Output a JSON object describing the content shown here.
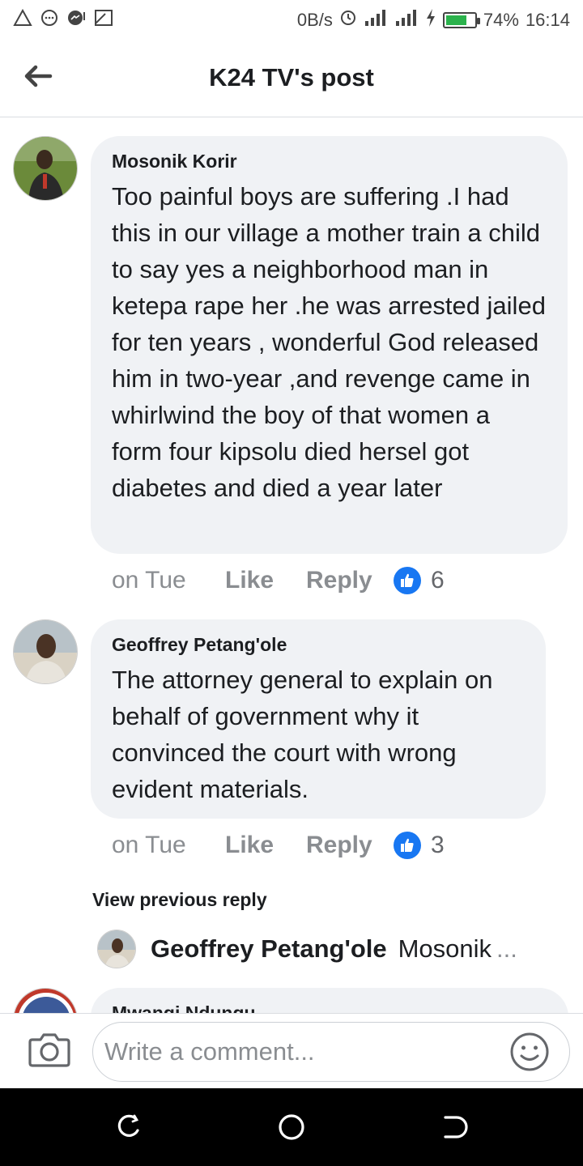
{
  "status_bar": {
    "network_speed": "0B/s",
    "battery_percent": "74%",
    "time": "16:14",
    "battery_level": 0.74,
    "icons": [
      "warning-icon",
      "message-icon",
      "messenger-icon",
      "image-icon",
      "sync-icon",
      "signal-icon",
      "signal-icon",
      "charging-icon",
      "battery-icon"
    ]
  },
  "header": {
    "title": "K24 TV's post",
    "back_icon": "arrow-left-icon"
  },
  "comments": [
    {
      "author": "Mosonik Korir",
      "text": "Too painful boys are suffering .I had this in our village a mother train a child to say yes a neighborhood man in ketepa rape her .he was arrested jailed for ten years , wonderful God released him in two-year ,and revenge came in whirlwind the boy of that women a form four kipsolu died hersel got diabetes and died a year later",
      "time": "on Tue",
      "like_label": "Like",
      "reply_label": "Reply",
      "reaction_count": "6"
    },
    {
      "author": "Geoffrey Petang'ole",
      "text": "The attorney general to explain on behalf of government why it convinced the court with wrong evident materials.",
      "time": "on Tue",
      "like_label": "Like",
      "reply_label": "Reply",
      "reaction_count": "3"
    }
  ],
  "view_previous_reply": "View previous reply",
  "sub_reply": {
    "author": "Geoffrey Petang'ole",
    "text": "Mosonik",
    "ellipsis": "..."
  },
  "partial_comment": {
    "author": "Mwangi Ndungu"
  },
  "composer": {
    "placeholder": "Write a comment..."
  },
  "colors": {
    "bubble": "#f0f2f5",
    "like_blue": "#1877f2",
    "meta_gray": "#8a8d91"
  }
}
